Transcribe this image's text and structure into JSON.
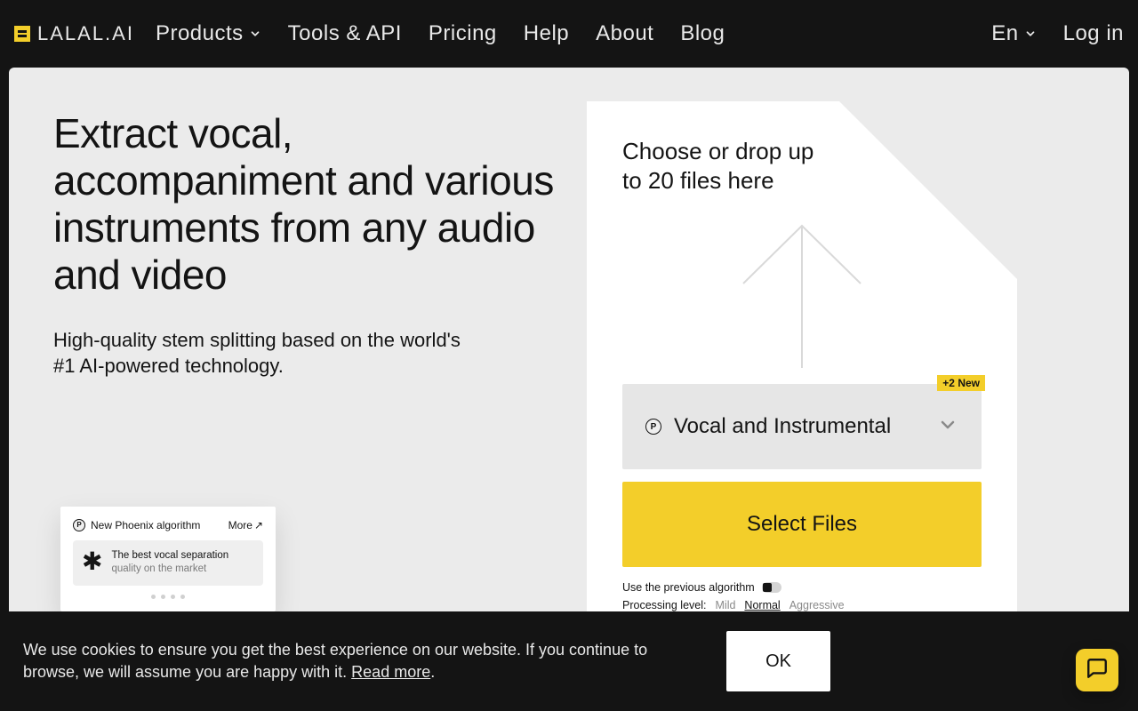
{
  "header": {
    "logo_text": "LALAL.AI",
    "nav": {
      "products": "Products",
      "tools": "Tools & API",
      "pricing": "Pricing",
      "help": "Help",
      "about": "About",
      "blog": "Blog"
    },
    "lang": "En",
    "login": "Log in"
  },
  "hero": {
    "title": "Extract vocal, accompaniment and various instruments from any audio and video",
    "subtitle": "High-quality stem splitting based on the world's #1 AI-powered technology."
  },
  "news": {
    "heading": "New Phoenix algorithm",
    "more": "More",
    "tile_line1": "The best vocal separation",
    "tile_line2": "quality on the market"
  },
  "upload": {
    "dropzone": "Choose or drop up to 20 files here",
    "new_badge": "+2 New",
    "stem_label": "Vocal and Instrumental",
    "select_files": "Select Files",
    "prev_algo_label": "Use the previous algorithm",
    "proc_level_label": "Processing level:",
    "levels": {
      "mild": "Mild",
      "normal": "Normal",
      "aggressive": "Aggressive"
    },
    "active_level": "normal"
  },
  "cookie": {
    "text": "We use cookies to ensure you get the best experience on our website. If you continue to browse, we will assume you are happy with it. ",
    "read_more": "Read more",
    "ok": "OK"
  }
}
